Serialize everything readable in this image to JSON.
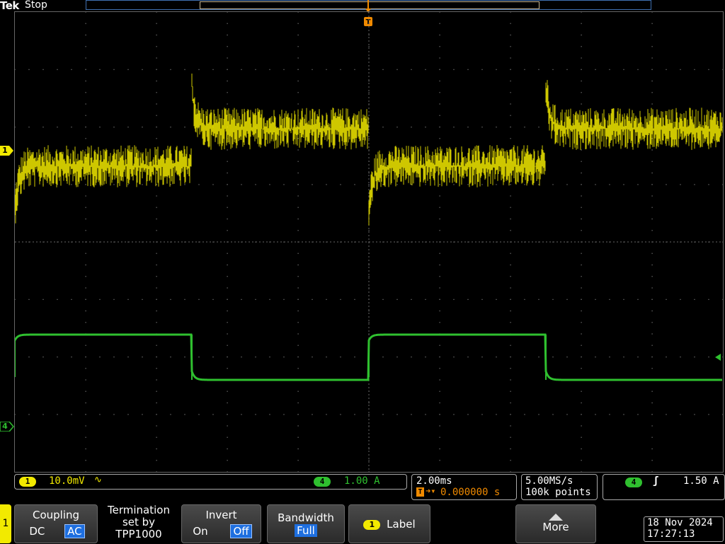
{
  "header": {
    "brand": "Tek",
    "run_state": "Stop"
  },
  "trigger_marker": {
    "label": "T"
  },
  "channel_markers": {
    "ch1": "1",
    "ch4": "4"
  },
  "status": {
    "ch1_badge": "1",
    "ch1_scale": "10.0mV",
    "ch1_coupling_icon": "ac-coupling-icon",
    "ch4_badge": "4",
    "ch4_scale": "1.00 A",
    "timebase": "2.00ms",
    "trigger_position": "0.000000 s",
    "sample_rate": "5.00MS/s",
    "record_length": "100k points",
    "trig_source_badge": "4",
    "trig_slope_icon": "rising-edge-icon",
    "trig_level": "1.50 A"
  },
  "menu": {
    "channel_tab": "1",
    "coupling_title": "Coupling",
    "coupling_dc": "DC",
    "coupling_ac": "AC",
    "termination_line1": "Termination",
    "termination_line2": "set by",
    "termination_line3": "TPP1000",
    "invert_title": "Invert",
    "invert_on": "On",
    "invert_off": "Off",
    "bandwidth_title": "Bandwidth",
    "bandwidth_value": "Full",
    "label_badge": "1",
    "label_text": "Label",
    "more_text": "More",
    "date": "18 Nov 2024",
    "time": "17:27:13"
  },
  "colors": {
    "ch1": "#f2ea00",
    "ch4": "#2fc02f",
    "trigger": "#f08a00",
    "selected": "#1e6fe0"
  }
}
